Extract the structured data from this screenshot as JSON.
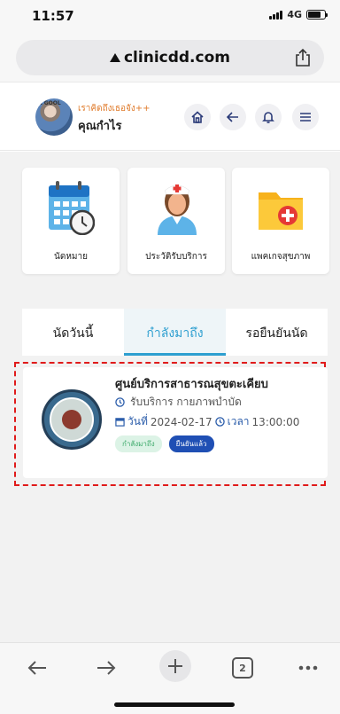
{
  "status_bar": {
    "time": "11:57",
    "network": "4G"
  },
  "browser": {
    "url": "clinicdd.com",
    "tab_count": "2"
  },
  "header": {
    "avatar_text": "A GOOL",
    "subtitle": "เราคิดถึงเธอจัง++",
    "user_name": "คุณกำไร"
  },
  "menu_tiles": [
    {
      "label": "นัดหมาย",
      "icon": "calendar-clock-icon"
    },
    {
      "label": "ประวัติรับบริการ",
      "icon": "nurse-icon"
    },
    {
      "label": "แพคเกจสุขภาพ",
      "icon": "health-folder-icon"
    }
  ],
  "tabs": [
    {
      "label": "นัดวันนี้",
      "active": false
    },
    {
      "label": "กำลังมาถึง",
      "active": true
    },
    {
      "label": "รอยืนยันนัด",
      "active": false
    }
  ],
  "appointment": {
    "clinic_name": "ศูนย์บริการสาธารณสุขตะเคียบ",
    "service": "รับบริการ กายภาพบำบัด",
    "date_label": "วันที่",
    "date": "2024-02-17",
    "time_label": "เวลา",
    "time": "13:00:00",
    "status_badge": "กำลังมาถึง",
    "confirm_badge": "ยืนยันแล้ว"
  },
  "colors": {
    "accent": "#2e9fd0",
    "orange": "#e07b2b",
    "confirm_blue": "#1f4fb4",
    "highlight_border": "#e01b1b"
  }
}
